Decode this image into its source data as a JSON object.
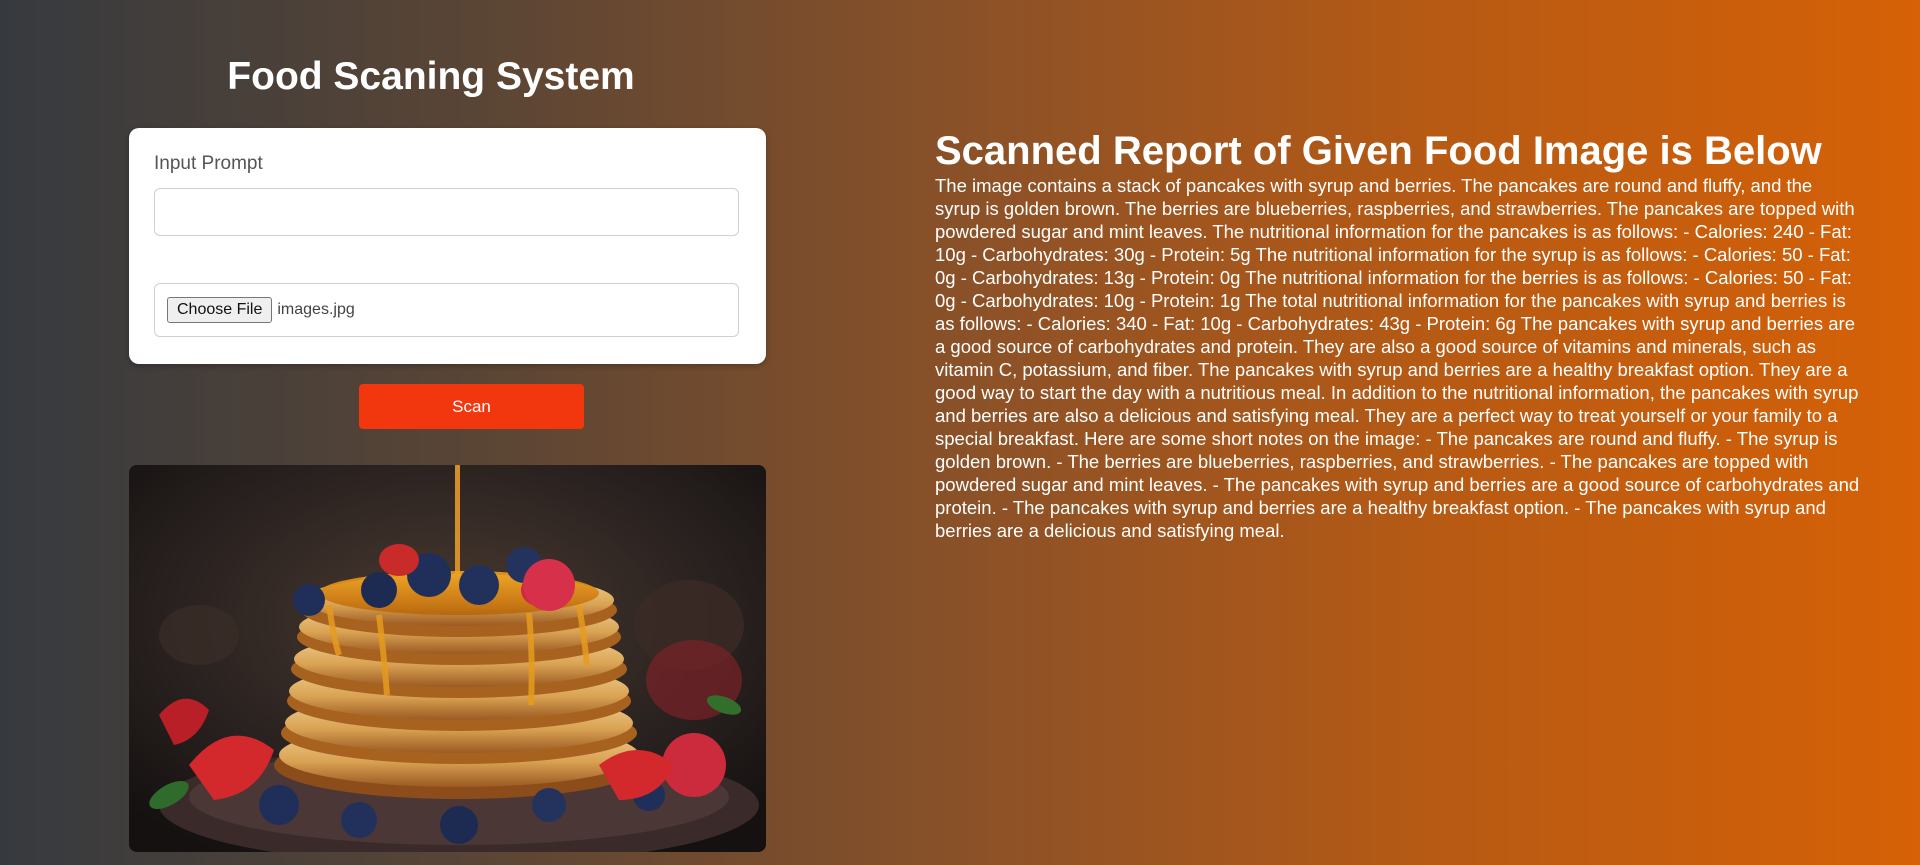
{
  "app": {
    "title": "Food Scaning System"
  },
  "form": {
    "prompt_label": "Input Prompt",
    "prompt_value": "",
    "file_button_label": "Choose File",
    "file_name": "images.jpg",
    "scan_label": "Scan"
  },
  "image": {
    "alt": "images.jpg"
  },
  "report": {
    "title": "Scanned Report of Given Food Image is Below",
    "body": "The image contains a stack of pancakes with syrup and berries. The pancakes are round and fluffy, and the syrup is golden brown. The berries are blueberries, raspberries, and strawberries. The pancakes are topped with powdered sugar and mint leaves. The nutritional information for the pancakes is as follows: - Calories: 240 - Fat: 10g - Carbohydrates: 30g - Protein: 5g The nutritional information for the syrup is as follows: - Calories: 50 - Fat: 0g - Carbohydrates: 13g - Protein: 0g The nutritional information for the berries is as follows: - Calories: 50 - Fat: 0g - Carbohydrates: 10g - Protein: 1g The total nutritional information for the pancakes with syrup and berries is as follows: - Calories: 340 - Fat: 10g - Carbohydrates: 43g - Protein: 6g The pancakes with syrup and berries are a good source of carbohydrates and protein. They are also a good source of vitamins and minerals, such as vitamin C, potassium, and fiber. The pancakes with syrup and berries are a healthy breakfast option. They are a good way to start the day with a nutritious meal. In addition to the nutritional information, the pancakes with syrup and berries are also a delicious and satisfying meal. They are a perfect way to treat yourself or your family to a special breakfast. Here are some short notes on the image: - The pancakes are round and fluffy. - The syrup is golden brown. - The berries are blueberries, raspberries, and strawberries. - The pancakes are topped with powdered sugar and mint leaves. - The pancakes with syrup and berries are a good source of carbohydrates and protein. - The pancakes with syrup and berries are a healthy breakfast option. - The pancakes with syrup and berries are a delicious and satisfying meal."
  },
  "colors": {
    "scan_button": "#f2360d",
    "gradient_start": "#363a3f",
    "gradient_end": "#d66106"
  }
}
